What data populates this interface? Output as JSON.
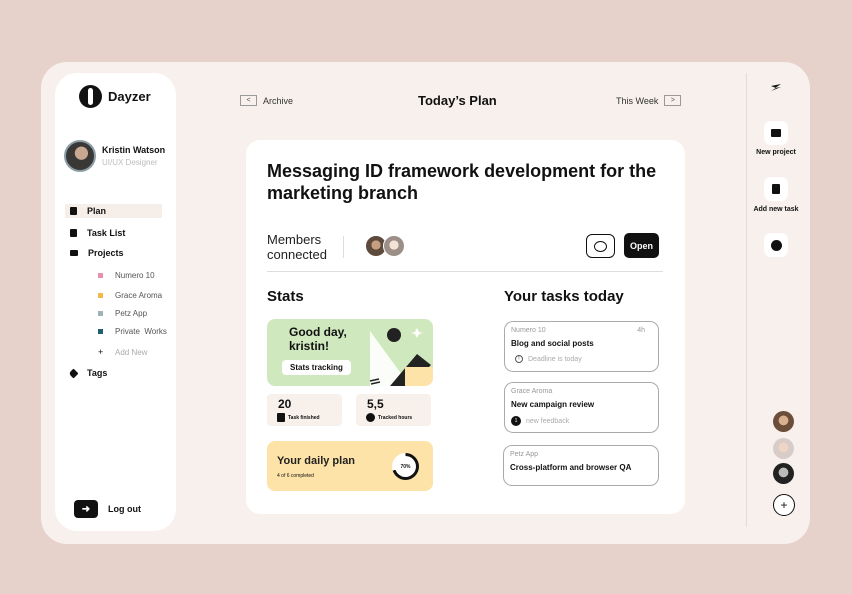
{
  "app_name": "Dayzer",
  "user": {
    "name": "Kristin Watson",
    "role": "UI/UX Designer"
  },
  "nav": {
    "plan": "Plan",
    "task_list": "Task List",
    "projects": "Projects",
    "tags": "Tags",
    "projects_items": [
      {
        "label": "Numero 10",
        "color": "#e88fae"
      },
      {
        "label": "Grace Aroma",
        "color": "#f5b84a"
      },
      {
        "label": "Petz App",
        "color": "#9fb2bb"
      },
      {
        "label": "Private  Works",
        "color": "#1e5f74"
      }
    ],
    "add_new": "Add New",
    "logout": "Log out"
  },
  "header": {
    "archive": "Archive",
    "title": "Today’s Plan",
    "this_week": "This Week",
    "prev": "<",
    "next": ">"
  },
  "main": {
    "task_title": "Messaging ID framework development for the marketing branch",
    "members_label": "Members connected",
    "open_button": "Open",
    "stats_title": "Stats",
    "greeting": "Good day, kristin!",
    "stats_tracking": "Stats tracking",
    "task_finished_value": "20",
    "task_finished_label": "Task finished",
    "tracked_hours_value": "5,5",
    "tracked_hours_label": "Tracked hours",
    "daily_plan_title": "Your daily plan",
    "daily_plan_sub": "4 of 6 completed",
    "daily_plan_percent": "70%",
    "daily_plan_progress": 0.7,
    "tasks_today_title": "Your tasks today",
    "tasks": [
      {
        "project": "Numero 10",
        "hours": "4h",
        "title": "Blog and social posts",
        "note": "Deadline is today"
      },
      {
        "project": "Grace Aroma",
        "hours": "",
        "title": "New campaign review",
        "note": "new feedback",
        "count": "1"
      },
      {
        "project": "Petz App",
        "hours": "",
        "title": "Cross-platform and browser QA",
        "note": ""
      }
    ]
  },
  "rail": {
    "new_project": "New project",
    "add_task": "Add new task",
    "add": "+"
  },
  "colors": {
    "background": "#e6d2cb",
    "greet_card": "#cfe8bd",
    "daily_card": "#fde3a7"
  }
}
